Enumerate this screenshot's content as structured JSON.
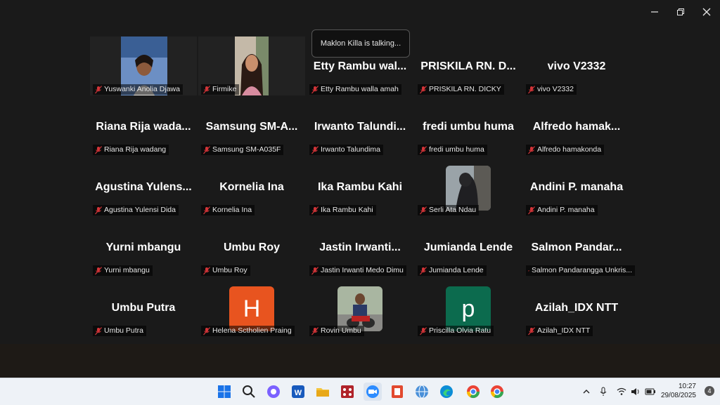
{
  "toast": {
    "text": "Maklon Killa is talking..."
  },
  "participants": [
    {
      "display": "",
      "label": "Yuswanki Anolia Djawa"
    },
    {
      "display": "",
      "label": "Firmike"
    },
    {
      "display": "Etty Rambu wal...",
      "label": "Etty Rambu walla amah"
    },
    {
      "display": "PRISKILA RN. D...",
      "label": "PRISKILA RN. DICKY"
    },
    {
      "display": "vivo V2332",
      "label": "vivo V2332"
    },
    {
      "display": "Riana Rija wada...",
      "label": "Riana Rija wadang"
    },
    {
      "display": "Samsung SM-A...",
      "label": "Samsung SM-A035F"
    },
    {
      "display": "Irwanto Talundi...",
      "label": "Irwanto Talundima"
    },
    {
      "display": "fredi umbu huma",
      "label": "fredi umbu huma"
    },
    {
      "display": "Alfredo hamak...",
      "label": "Alfredo hamakonda"
    },
    {
      "display": "Agustina Yulens...",
      "label": "Agustina Yulensi Dida"
    },
    {
      "display": "Kornelia Ina",
      "label": "Kornelia Ina"
    },
    {
      "display": "Ika Rambu Kahi",
      "label": "Ika Rambu Kahi"
    },
    {
      "display": "",
      "label": "Serli Ata Ndau"
    },
    {
      "display": "Andini P. manaha",
      "label": "Andini P. manaha"
    },
    {
      "display": "Yurni mbangu",
      "label": "Yurni mbangu"
    },
    {
      "display": "Umbu Roy",
      "label": "Umbu Roy"
    },
    {
      "display": "Jastin Irwanti...",
      "label": "Jastin Irwanti Medo Dimu"
    },
    {
      "display": "Jumianda Lende",
      "label": "Jumianda Lende"
    },
    {
      "display": "Salmon Pandar...",
      "label": "Salmon Pandarangga Unkris..."
    },
    {
      "display": "Umbu Putra",
      "label": "Umbu Putra"
    },
    {
      "display": "",
      "label": "Helena Sctholien Praing",
      "avatar_letter": "H",
      "avatar_color": "#e8541f"
    },
    {
      "display": "",
      "label": "Rovin Umbu"
    },
    {
      "display": "",
      "label": "Priscilla Olvia Ratu",
      "avatar_letter": "p",
      "avatar_color": "#0c6b4e"
    },
    {
      "display": "Azilah_IDX NTT",
      "label": "Azilah_IDX NTT"
    }
  ],
  "taskbar": {
    "time": "10:27",
    "date": "29/08/2025",
    "notifications": "4"
  },
  "colors": {
    "mic_muted": "#d13438",
    "toast_bg": "#111111"
  }
}
